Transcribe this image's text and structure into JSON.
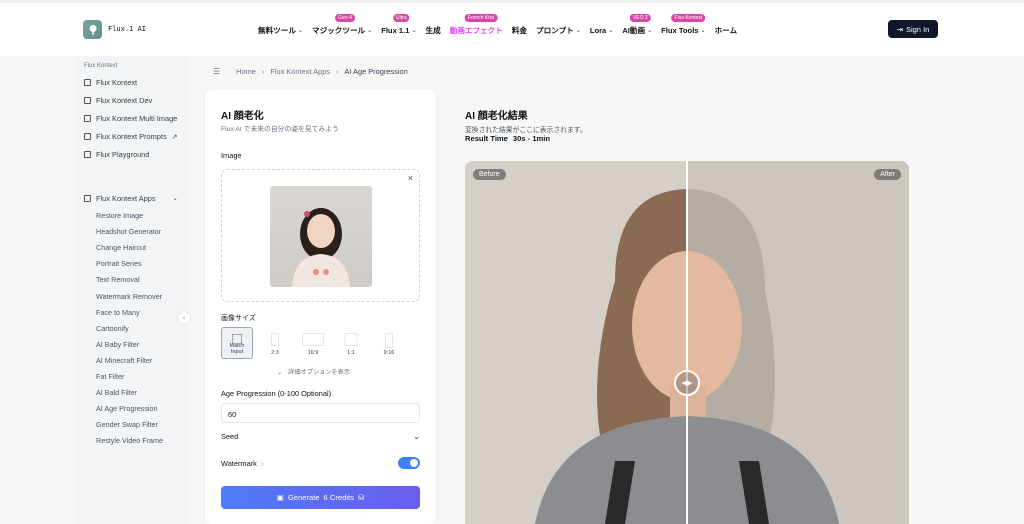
{
  "header": {
    "brand": "Flux.1 AI",
    "nav": [
      {
        "label": "無料ツール",
        "chev": true
      },
      {
        "label": "マジックツール",
        "chev": true,
        "badge": "Gen-4"
      },
      {
        "label": "Flux 1.1",
        "chev": true,
        "badge": "Ultra"
      },
      {
        "label": "生成",
        "chev": false
      },
      {
        "label": "動画エフェクト",
        "chev": false,
        "badge": "French Kiss",
        "pink": true
      },
      {
        "label": "料金",
        "chev": false
      },
      {
        "label": "プロンプト",
        "chev": true
      },
      {
        "label": "Lora",
        "chev": true
      },
      {
        "label": "AI動画",
        "chev": true,
        "badge": "VEO 3"
      },
      {
        "label": "Flux Tools",
        "chev": true,
        "badge": "Flux Kontext"
      },
      {
        "label": "ホーム",
        "chev": false
      }
    ],
    "signin": "Sign In"
  },
  "sidebar": {
    "section_title": "Flux Kontext",
    "items": [
      "Flux Kontext",
      "Flux Kontext Dev",
      "Flux Kontext Multi Image",
      "Flux Kontext Prompts",
      "Flux Playground"
    ],
    "apps_label": "Flux Kontext Apps",
    "apps": [
      "Restore Image",
      "Headshot Generator",
      "Change Haircut",
      "Portrait Series",
      "Text Removal",
      "Watermark Remover",
      "Face to Many",
      "Cartoonify",
      "AI Baby Filter",
      "AI Minecraft Filter",
      "Fat Filter",
      "AI Bald Filter",
      "AI Age Progression",
      "Gender Swap Filter",
      "Restyle Video Frame"
    ]
  },
  "breadcrumb": [
    "Home",
    "Flux Kontext Apps",
    "AI Age Progression"
  ],
  "form": {
    "title": "AI 顔老化",
    "subtitle": "Flux AI で未来の自分の姿を見てみよう",
    "image_label": "Image",
    "size_label": "画像サイズ",
    "sizes": [
      "Match Input",
      "2:3",
      "16:9",
      "1:1",
      "9:16"
    ],
    "selected_size": "Match Input",
    "more_options": "詳細オプションを表示",
    "age_label": "Age Progression (0-100 Optional)",
    "age_value": "60",
    "seed_label": "Seed",
    "watermark_label": "Watermark",
    "watermark_on": true,
    "generate_label": "Generate",
    "credits_label": "6 Credits"
  },
  "result": {
    "title": "AI 顔老化結果",
    "subtitle": "変換された結果がここに表示されます。",
    "time_label": "Result Time",
    "time_value": "30s - 1min",
    "before_label": "Before",
    "after_label": "After"
  },
  "colors": {
    "accent": "#4f7cf5",
    "badge": "#d946a8",
    "dark": "#0f172a"
  }
}
